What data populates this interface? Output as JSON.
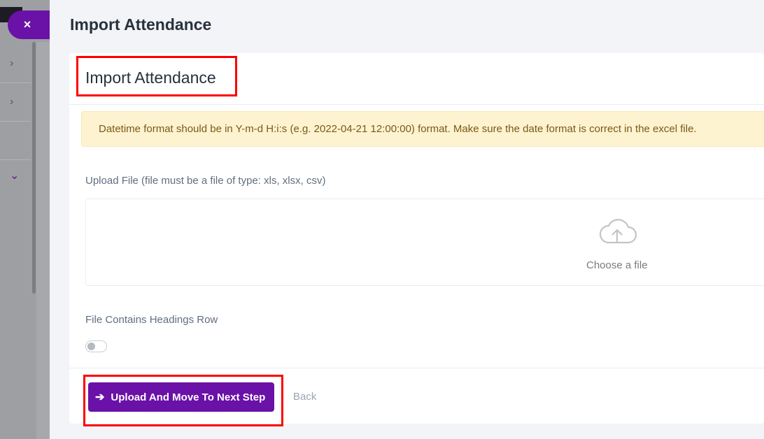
{
  "page_title": "Import Attendance",
  "card": {
    "title": "Import Attendance",
    "alert_text": "Datetime format should be in Y-m-d H:i:s (e.g. 2022-04-21 12:00:00) format. Make sure the date format is correct in the excel file.",
    "upload_label": "Upload File (file must be a file of type: xls, xlsx, csv)",
    "dropzone_text": "Choose a file",
    "headings_label": "File Contains Headings Row",
    "headings_toggle_on": false,
    "primary_button": "Upload And Move To Next Step",
    "back_link": "Back"
  },
  "close_button": "×",
  "icons": {
    "close": "close-icon",
    "cloud": "cloud-upload-icon",
    "arrow": "arrow-right-icon",
    "chevron_right": "chevron-right-icon",
    "chevron_down": "chevron-down-icon"
  },
  "colors": {
    "accent": "#6a11a8",
    "alert_bg": "#fdf3d0",
    "highlight": "#ff0000"
  }
}
